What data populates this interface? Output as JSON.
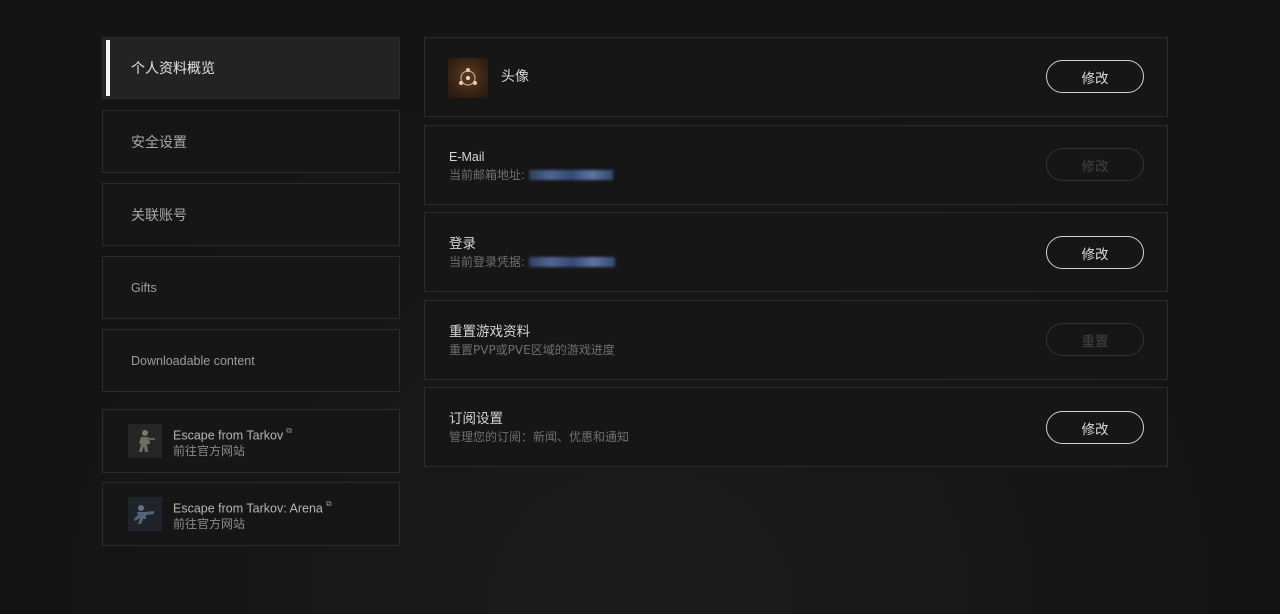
{
  "sidebar": {
    "items": [
      {
        "label": "个人资料概览"
      },
      {
        "label": "安全设置"
      },
      {
        "label": "关联账号"
      },
      {
        "label": "Gifts"
      },
      {
        "label": "Downloadable content"
      }
    ],
    "external": [
      {
        "title": "Escape from Tarkov",
        "subtitle": "前往官方网站",
        "icon": "tarkov-soldier-icon"
      },
      {
        "title": "Escape from Tarkov: Arena",
        "subtitle": "前往官方网站",
        "icon": "arena-soldier-icon"
      }
    ]
  },
  "cards": {
    "avatar": {
      "title": "头像",
      "button": "修改"
    },
    "email": {
      "title": "E-Mail",
      "subtitle": "当前邮箱地址:",
      "button": "修改"
    },
    "login": {
      "title": "登录",
      "subtitle": "当前登录凭据:",
      "button": "修改"
    },
    "reset": {
      "title": "重置游戏资料",
      "subtitle": "重置PVP或PVE区域的游戏进度",
      "button": "重置"
    },
    "subscription": {
      "title": "订阅设置",
      "subtitle": "管理您的订阅：新闻、优惠和通知",
      "button": "修改"
    }
  },
  "colors": {
    "background": "#161616",
    "card_border": "#2c2c2c",
    "active_bg": "#232323",
    "accent_bar": "#f2f2f2"
  }
}
